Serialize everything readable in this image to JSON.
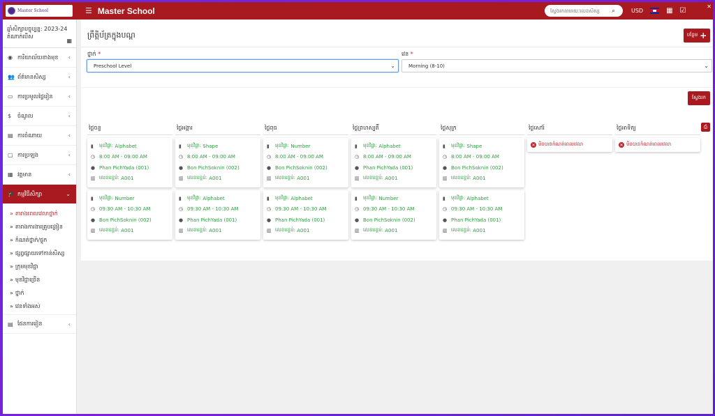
{
  "app": {
    "logo_text": "Master School",
    "title": "Master School",
    "search_placeholder": "ស្វែងរកតាមរយៈលេខសិស្ស",
    "currency": "USD"
  },
  "sidebar": {
    "year_label": "ឆ្នាំសិក្សាបច្ចុប្បន្ន: 2023-24",
    "branch_label": "តំណាក់បើស",
    "items": [
      {
        "label": "ការិយាល័យខាងមុខ",
        "icon": "dashboard-icon"
      },
      {
        "label": "ព័ត៌មានសិស្ស",
        "icon": "users-icon"
      },
      {
        "label": "ការប្រមូលថ្លៃរៀន",
        "icon": "money-icon"
      },
      {
        "label": "ចំណូល",
        "icon": "dollar-icon"
      },
      {
        "label": "ការចំណាយ",
        "icon": "credit-card-icon"
      },
      {
        "label": "ការប្រឡង",
        "icon": "map-icon"
      },
      {
        "label": "វត្តមាន",
        "icon": "calendar-icon"
      },
      {
        "label": "កម្មវិធីសិក្សា",
        "icon": "graduation-icon"
      }
    ],
    "sub_items": [
      "តារាងពេលវេលាថ្នាក់",
      "តារាងការងារគ្រូបង្រៀន",
      "កំណត់ថ្នាក់/ផ្ទុក",
      "ផ្សព្វផ្សាយទៅកាន់សិស្ស",
      "ក្រុមមុខវិជ្ជា",
      "មុខវិជ្ជាច្រើន",
      "ថ្នាក់",
      "វេនទាំងអស់"
    ],
    "last_item": "ផែនការរៀន"
  },
  "main": {
    "page_title": "ព្រឹត្តិប័ត្រក្នុងបណ្ដ",
    "add_label": "បន្ថែម",
    "class_label": "ថ្នាក់",
    "class_value": "Preschool Level",
    "shift_label": "វេន",
    "shift_value": "Morning (8-10)",
    "search_label": "ស្វែងរក"
  },
  "schedule": {
    "subject_prefix": "មុខវិជ្ជា:",
    "room_prefix": "លេខបន្ទប់:",
    "empty_text": "មិនបានកំណត់ពេលវេលា",
    "days": [
      {
        "name": "ថ្ងៃចន្ទ",
        "slots": [
          {
            "subject": "Alphabet",
            "time": "8:00 AM - 09:00 AM",
            "teacher": "Phan PichYada (001)",
            "room": "A001"
          },
          {
            "subject": "Number",
            "time": "09:30 AM - 10:30 AM",
            "teacher": "Bon PichSoknin (002)",
            "room": "A001"
          }
        ]
      },
      {
        "name": "ថ្ងៃអង្គារ",
        "slots": [
          {
            "subject": "Shape",
            "time": "8:00 AM - 09:00 AM",
            "teacher": "Bon PichSoknin (002)",
            "room": "A001"
          },
          {
            "subject": "Alphabet",
            "time": "09:30 AM - 10:30 AM",
            "teacher": "Phan PichYada (001)",
            "room": "A001"
          }
        ]
      },
      {
        "name": "ថ្ងៃពុធ",
        "slots": [
          {
            "subject": "Number",
            "time": "8:00 AM - 09:00 AM",
            "teacher": "Bon PichSoknin (002)",
            "room": "A001"
          },
          {
            "subject": "Alphabet",
            "time": "09:30 AM - 10:30 AM",
            "teacher": "Phan PichYada (001)",
            "room": "A001"
          }
        ]
      },
      {
        "name": "ថ្ងៃព្រហស្បតិ៍",
        "slots": [
          {
            "subject": "Alphabet",
            "time": "8:00 AM - 09:00 AM",
            "teacher": "Phan PichYada (001)",
            "room": "A001"
          },
          {
            "subject": "Number",
            "time": "09:30 AM - 10:30 AM",
            "teacher": "Bon PichSoknin (002)",
            "room": "A001"
          }
        ]
      },
      {
        "name": "ថ្ងៃសុក្រ",
        "slots": [
          {
            "subject": "Shape",
            "time": "8:00 AM - 09:00 AM",
            "teacher": "Bon PichSoknin (002)",
            "room": "A001"
          },
          {
            "subject": "Alphabet",
            "time": "09:30 AM - 10:30 AM",
            "teacher": "Phan PichYada (001)",
            "room": "A001"
          }
        ]
      },
      {
        "name": "ថ្ងៃសៅរ៍",
        "slots": []
      },
      {
        "name": "ថ្ងៃអាទិត្យ",
        "slots": []
      }
    ]
  },
  "colors": {
    "brand": "#a81a1f",
    "slot_text": "#2e9d3f",
    "empty_text": "#c0272d"
  }
}
